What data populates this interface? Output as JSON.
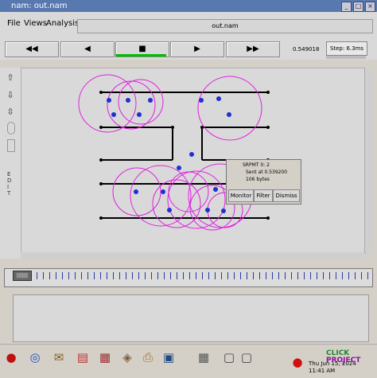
{
  "window": {
    "title": "nam: out.nam"
  },
  "menu": {
    "file": "File",
    "views": "Views",
    "analysis": "Analysis"
  },
  "file_label": "out.nam",
  "controls": {
    "rewind": "◀◀",
    "back": "◀",
    "stop": "■",
    "play": "▶",
    "ffwd": "▶▶"
  },
  "time_display": "0.549018",
  "step": "Step: 6.3ms",
  "tools": {
    "edit_label": "E\nD\nI\nT"
  },
  "popup": {
    "line1": "SRPMT 0: 2",
    "line2": "Sent at 0.539200",
    "line3": "106 bytes",
    "monitor": "Monitor",
    "filter": "Filter",
    "dismiss": "Dismiss"
  },
  "timeline": {
    "knob": "|||||||"
  },
  "taskbar": {
    "time": "11:41 AM",
    "date": "Thu Jun 15, 2024"
  },
  "watermark": "CLICK my PROJECT",
  "colors": {
    "titlebar": "#5878b0",
    "node": "#2030d0",
    "range": "#e020e0",
    "stop_indicator": "#00bf00",
    "tick": "#2a3aa0"
  }
}
